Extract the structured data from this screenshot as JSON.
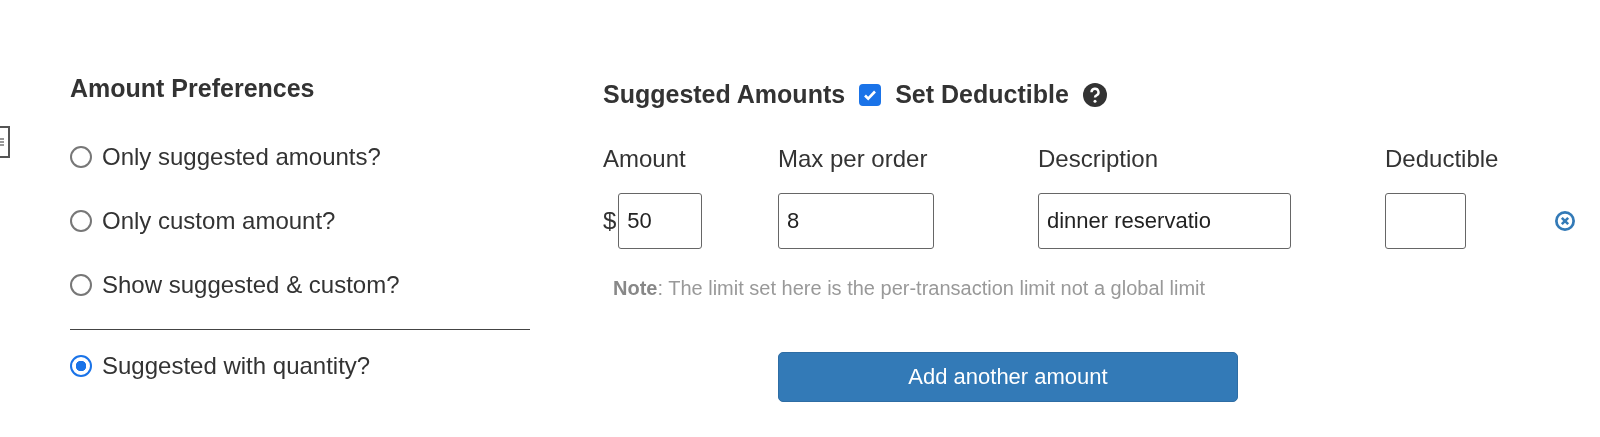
{
  "amount_preferences": {
    "title": "Amount Preferences",
    "options": [
      {
        "label": "Only suggested amounts?",
        "selected": false
      },
      {
        "label": "Only custom amount?",
        "selected": false
      },
      {
        "label": "Show suggested & custom?",
        "selected": false
      }
    ],
    "extra_options": [
      {
        "label": "Suggested with quantity?",
        "selected": true
      }
    ]
  },
  "suggested_amounts": {
    "title": "Suggested Amounts",
    "set_deductible": {
      "label": "Set Deductible",
      "checked": true
    },
    "columns": [
      "Amount",
      "Max per order",
      "Description",
      "Deductible"
    ],
    "rows": [
      {
        "currency": "$",
        "amount": "50",
        "max_per_order": "8",
        "description": "dinner reservatio"
      }
    ],
    "note": "**Note**: The limit set here is the per-transaction limit not a global limit",
    "add_button": "Add another amount"
  }
}
